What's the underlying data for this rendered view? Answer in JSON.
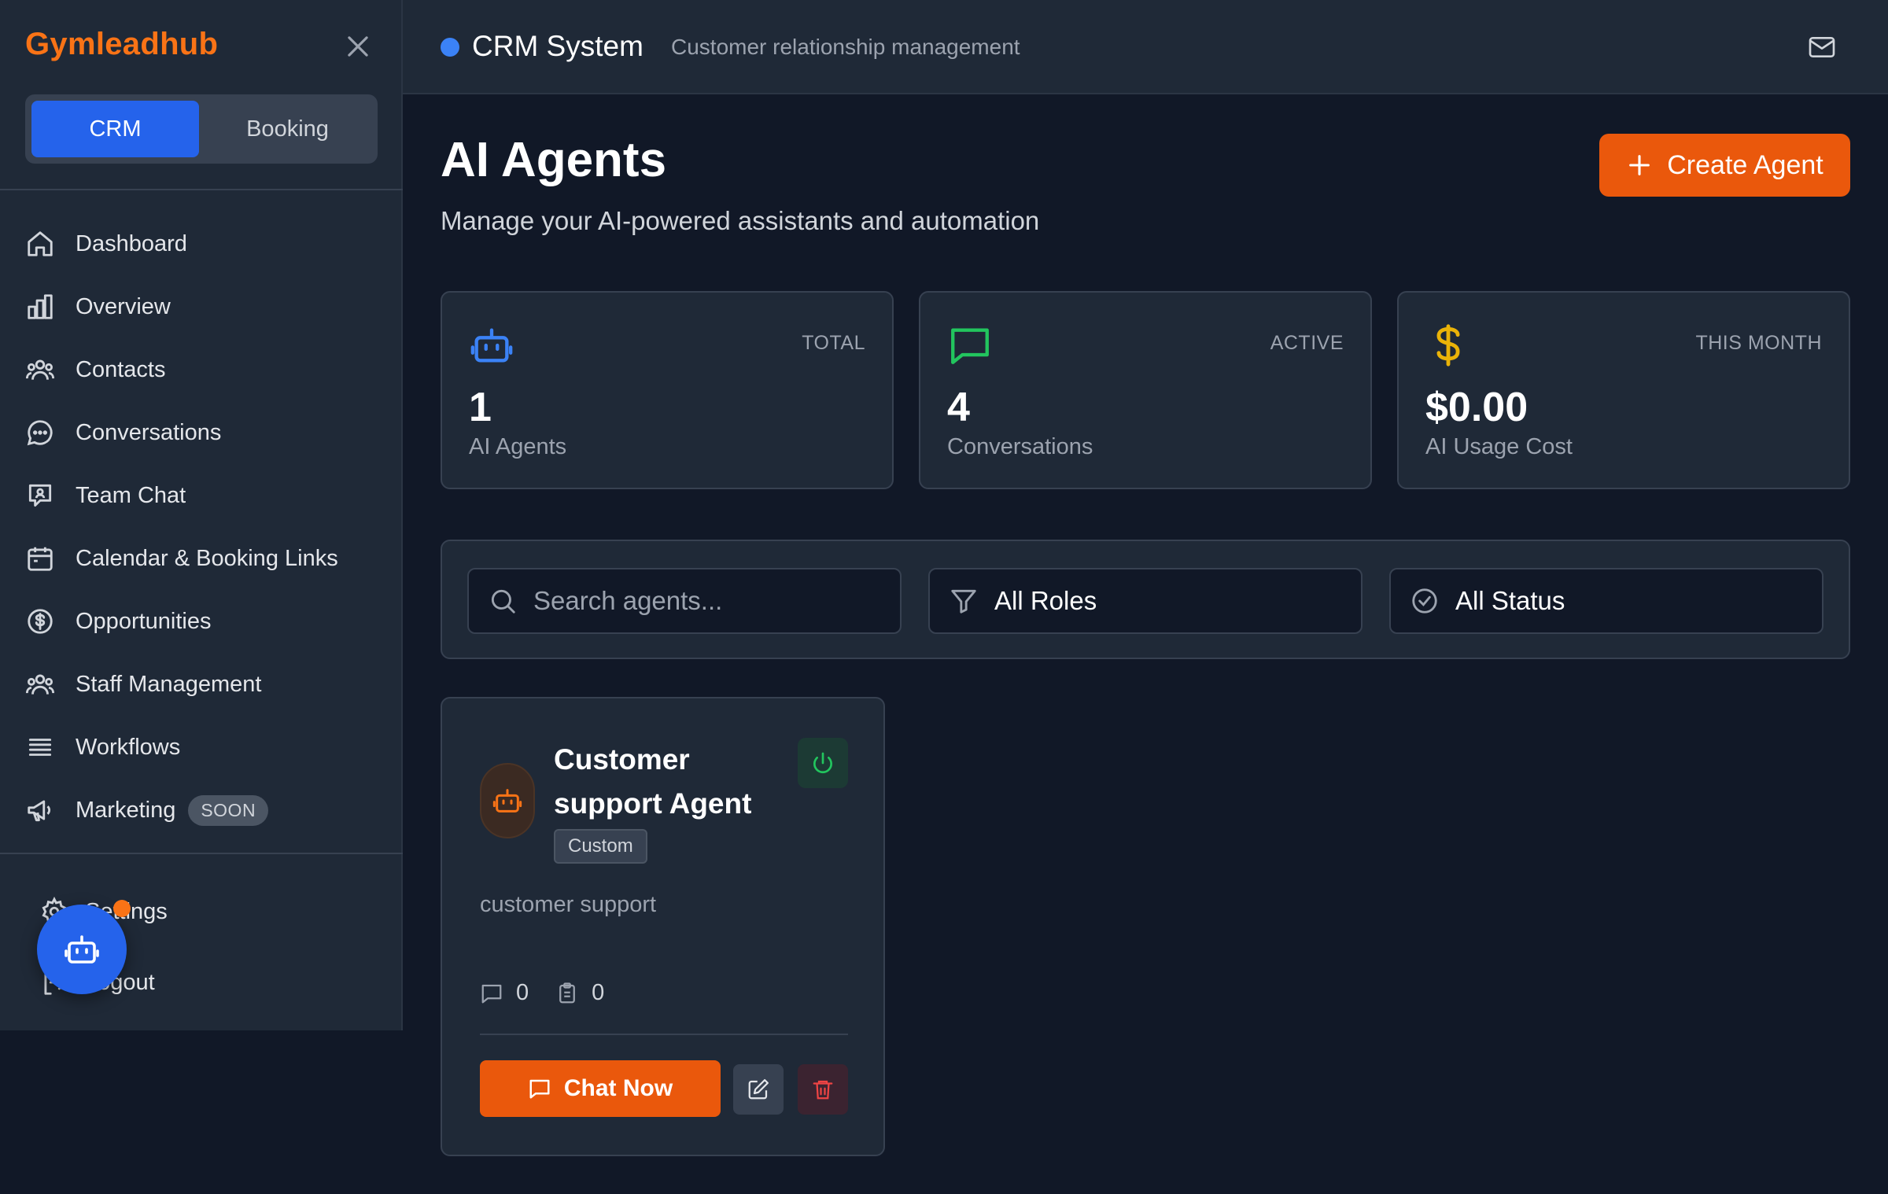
{
  "sidebar": {
    "brand": "Gymleadhub",
    "mode_tabs": [
      {
        "label": "CRM",
        "active": true
      },
      {
        "label": "Booking",
        "active": false
      }
    ],
    "items": [
      {
        "label": "Dashboard",
        "icon": "home-icon"
      },
      {
        "label": "Overview",
        "icon": "bar-chart-icon"
      },
      {
        "label": "Contacts",
        "icon": "users-icon"
      },
      {
        "label": "Conversations",
        "icon": "message-circle-icon"
      },
      {
        "label": "Team Chat",
        "icon": "team-chat-icon"
      },
      {
        "label": "Calendar & Booking Links",
        "icon": "calendar-icon"
      },
      {
        "label": "Opportunities",
        "icon": "dollar-circle-icon"
      },
      {
        "label": "Staff Management",
        "icon": "users-icon"
      },
      {
        "label": "Workflows",
        "icon": "list-icon"
      },
      {
        "label": "Marketing",
        "icon": "megaphone-icon",
        "badge": "SOON"
      }
    ],
    "bottom_items": [
      {
        "label": "Settings",
        "icon": "gear-icon"
      },
      {
        "label": "Logout",
        "icon": "logout-icon"
      }
    ]
  },
  "topbar": {
    "title": "CRM System",
    "subtitle": "Customer relationship management",
    "status_color": "#3b82f6"
  },
  "main": {
    "title": "AI Agents",
    "subtitle": "Manage your AI-powered assistants and automation",
    "create_button": "Create Agent"
  },
  "stats": [
    {
      "label": "TOTAL",
      "value": "1",
      "caption": "AI Agents",
      "icon": "bot-icon",
      "color": "#3b82f6"
    },
    {
      "label": "ACTIVE",
      "value": "4",
      "caption": "Conversations",
      "icon": "message-square-icon",
      "color": "#22c55e"
    },
    {
      "label": "THIS MONTH",
      "value": "$0.00",
      "caption": "AI Usage Cost",
      "icon": "dollar-icon",
      "color": "#eab308"
    }
  ],
  "filters": {
    "search_placeholder": "Search agents...",
    "role": "All Roles",
    "status": "All Status"
  },
  "agents": [
    {
      "name": "Customer support Agent",
      "tag": "Custom",
      "description": "customer support",
      "conversations": "0",
      "tasks": "0",
      "chat_label": "Chat Now"
    }
  ],
  "colors": {
    "accent": "#ea580c",
    "brand": "#f97316",
    "primary": "#2563eb"
  }
}
